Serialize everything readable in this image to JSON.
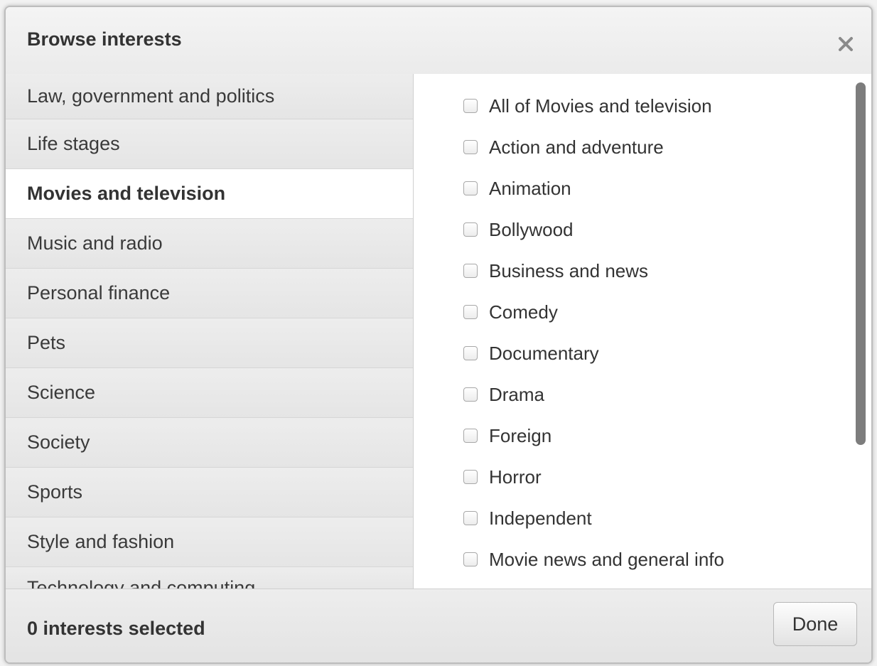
{
  "dialog": {
    "title": "Browse interests",
    "close_icon": "close-icon"
  },
  "categories": [
    "Law, government and politics",
    "Life stages",
    "Movies and television",
    "Music and radio",
    "Personal finance",
    "Pets",
    "Science",
    "Society",
    "Sports",
    "Style and fashion",
    "Technology and computing"
  ],
  "selected_category": "Movies and television",
  "options": [
    "All of Movies and television",
    "Action and adventure",
    "Animation",
    "Bollywood",
    "Business and news",
    "Comedy",
    "Documentary",
    "Drama",
    "Foreign",
    "Horror",
    "Independent",
    "Movie news and general info"
  ],
  "footer": {
    "selected_count": "0 interests selected",
    "done_label": "Done"
  },
  "colors": {
    "panel": "#f0f0f0",
    "active_item": "#ffffff",
    "scrollbar": "#7d7d7d"
  }
}
